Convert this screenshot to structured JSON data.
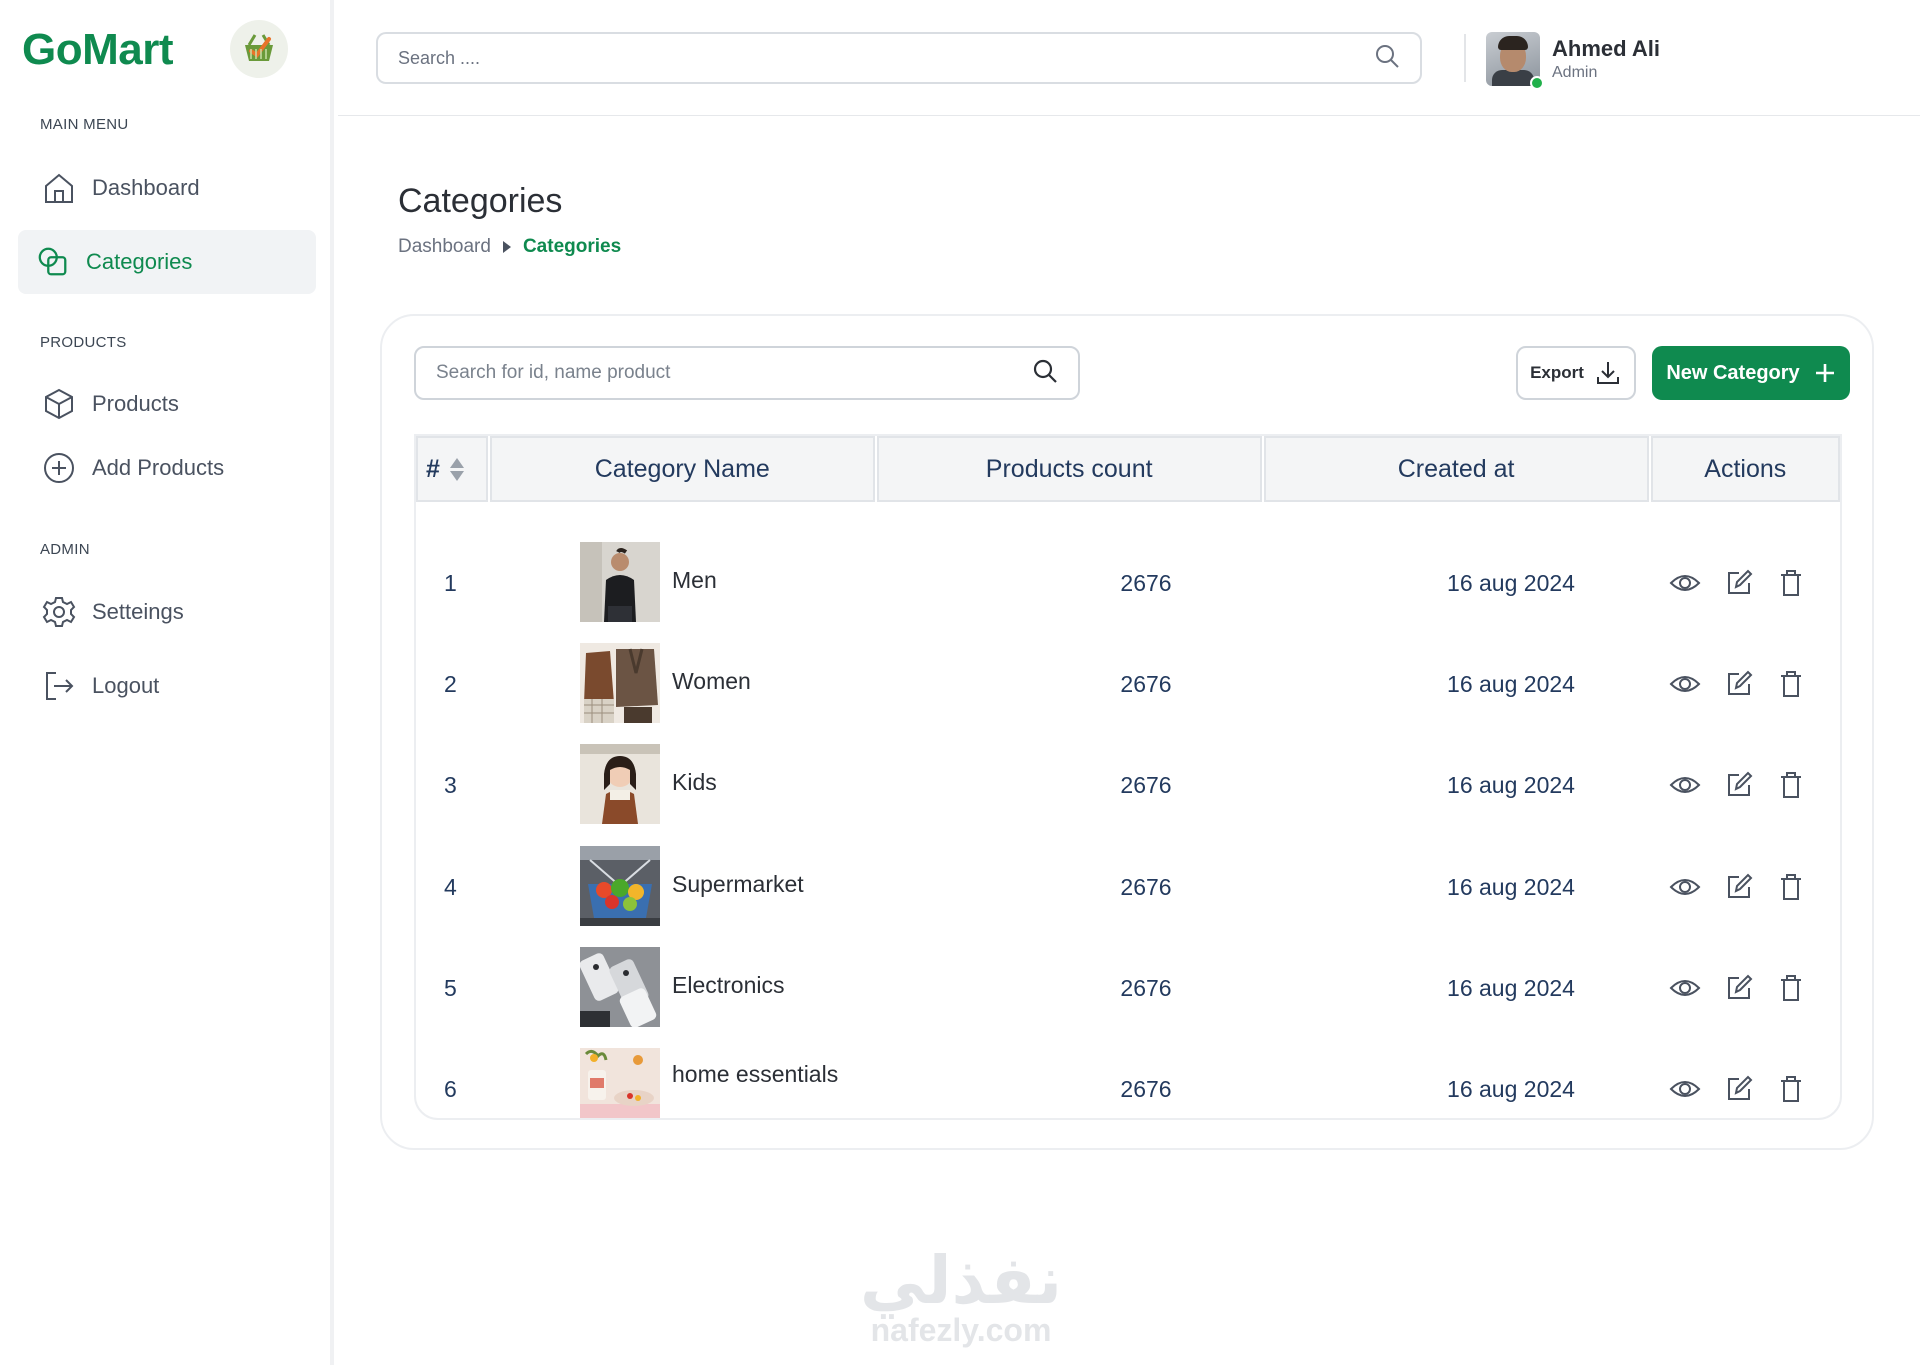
{
  "brand": {
    "name": "GoMart"
  },
  "sidebar": {
    "sections": [
      {
        "title": "MAIN MENU"
      },
      {
        "title": "PRODUCTS"
      },
      {
        "title": "ADMIN"
      }
    ],
    "items": [
      {
        "label": "Dashboard",
        "icon": "home-icon"
      },
      {
        "label": "Categories",
        "icon": "categories-icon",
        "active": true
      },
      {
        "label": "Products",
        "icon": "box-icon"
      },
      {
        "label": "Add Products",
        "icon": "plus-circle-icon"
      },
      {
        "label": "Setteings",
        "icon": "gear-icon"
      },
      {
        "label": "Logout",
        "icon": "logout-icon"
      }
    ]
  },
  "topbar": {
    "search_placeholder": "Search ....",
    "user": {
      "name": "Ahmed Ali",
      "role": "Admin",
      "online": true
    }
  },
  "page": {
    "title": "Categories",
    "breadcrumb": {
      "home": "Dashboard",
      "current": "Categories"
    }
  },
  "toolbar": {
    "search_placeholder": "Search for id, name product",
    "export_label": "Export",
    "new_label": "New Category"
  },
  "table": {
    "columns": [
      "#",
      "Category Name",
      "Products count",
      "Created at",
      "Actions"
    ],
    "rows": [
      {
        "id": "1",
        "name": "Men",
        "count": "2676",
        "created": "16 aug 2024"
      },
      {
        "id": "2",
        "name": "Women",
        "count": "2676",
        "created": "16 aug 2024"
      },
      {
        "id": "3",
        "name": "Kids",
        "count": "2676",
        "created": "16 aug 2024"
      },
      {
        "id": "4",
        "name": "Supermarket",
        "count": "2676",
        "created": "16 aug 2024"
      },
      {
        "id": "5",
        "name": "Electronics",
        "count": "2676",
        "created": "16 aug 2024"
      },
      {
        "id": "6",
        "name": "home essentials",
        "count": "2676",
        "created": "16 aug 2024"
      }
    ]
  },
  "watermark": {
    "arabic": "نفذلي",
    "latin": "nafezly.com"
  },
  "colors": {
    "accent": "#0f8a4f",
    "text_dark": "#233a5e",
    "online": "#21b04b"
  }
}
